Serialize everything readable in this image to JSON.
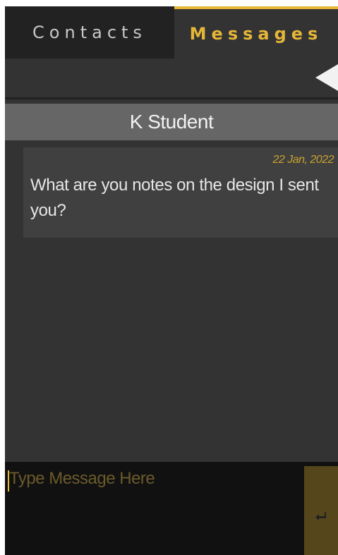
{
  "tabs": [
    {
      "label": "Contacts",
      "active": false
    },
    {
      "label": "Messages",
      "active": true
    }
  ],
  "toolbar": {
    "back_icon": "back-triangle-icon"
  },
  "contact": {
    "name": "K Student"
  },
  "conversation": {
    "messages": [
      {
        "date": "22 Jan, 2022",
        "text": "What are you notes on the design I sent you?"
      }
    ]
  },
  "composer": {
    "placeholder": "Type Message Here",
    "value": "",
    "send_icon": "enter-icon"
  },
  "colors": {
    "accent": "#e5b637",
    "background": "#333333",
    "tab_inactive_bg": "#222222",
    "header_bg": "#666666",
    "bubble_bg": "#404040",
    "composer_bg": "#111111",
    "send_bg": "#56461b"
  }
}
